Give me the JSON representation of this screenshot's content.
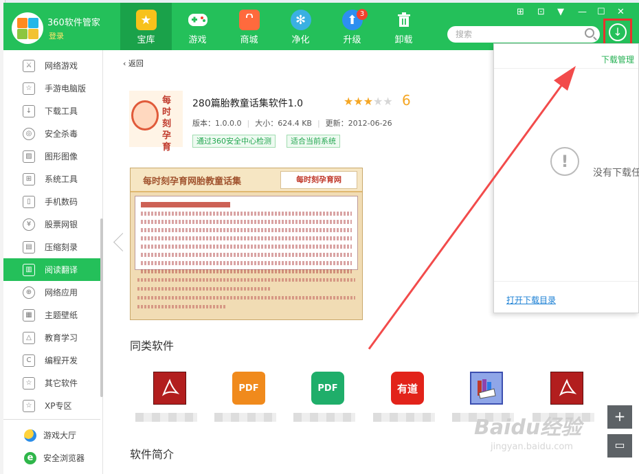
{
  "app": {
    "brand": "360软件管家",
    "login": "登录"
  },
  "nav": [
    {
      "label": "宝库",
      "color": "#f7c21b"
    },
    {
      "label": "游戏",
      "color": "#ffffff"
    },
    {
      "label": "商城",
      "color": "#ff6a3d"
    },
    {
      "label": "净化",
      "color": "#3ab0e2"
    },
    {
      "label": "升级",
      "color": "#2d8ff0",
      "badge": "3"
    },
    {
      "label": "卸载",
      "color": "#ffffff"
    }
  ],
  "search": {
    "placeholder": "搜索"
  },
  "sidebar": {
    "items": [
      {
        "label": "网络游戏"
      },
      {
        "label": "手游电脑版"
      },
      {
        "label": "下载工具"
      },
      {
        "label": "安全杀毒"
      },
      {
        "label": "图形图像"
      },
      {
        "label": "系统工具"
      },
      {
        "label": "手机数码"
      },
      {
        "label": "股票网银"
      },
      {
        "label": "压缩刻录"
      },
      {
        "label": "阅读翻译"
      },
      {
        "label": "网络应用"
      },
      {
        "label": "主题壁纸"
      },
      {
        "label": "教育学习"
      },
      {
        "label": "编程开发"
      },
      {
        "label": "其它软件"
      },
      {
        "label": "XP专区"
      }
    ],
    "apps": [
      {
        "label": "游戏大厅"
      },
      {
        "label": "安全浏览器"
      }
    ]
  },
  "detail": {
    "back": "返回",
    "title": "280篇胎教童话集软件1.0",
    "rating": "6",
    "stars_on": 3,
    "version_label": "版本：1.0.0.0",
    "size_label": "大小：624.4 KB",
    "update_label": "更新：2012-06-26",
    "tags": [
      "通过360安全中心检测",
      "适合当前系统"
    ],
    "logo_text": "每时刻孕育",
    "screenshot": {
      "title": "每时刻孕育网胎教童话集",
      "site": "每时刻孕育网"
    }
  },
  "sections": {
    "similar": "同类软件",
    "intro": "软件简介"
  },
  "similar_apps": [
    {
      "icon": "acrobat",
      "color": "#b21e1e",
      "text": "A"
    },
    {
      "icon": "foxit-pdf",
      "color": "#f08a1c",
      "text": "PDF"
    },
    {
      "icon": "pdf",
      "color": "#1fae6a",
      "text": "PDF"
    },
    {
      "icon": "youdao",
      "color": "#e2231a",
      "text": "有道"
    },
    {
      "icon": "dictionary",
      "color": "#5a6fd6",
      "text": ""
    },
    {
      "icon": "acrobat",
      "color": "#b21e1e",
      "text": "A"
    }
  ],
  "download_popup": {
    "title": "下载管理",
    "empty": "没有下载任",
    "open_dir": "打开下载目录"
  },
  "watermark": {
    "main": "Baidu经验",
    "sub": "jingyan.baidu.com"
  },
  "colors": {
    "brand_green": "#24c05a",
    "highlight_red": "#e8322d",
    "star": "#f5a623"
  }
}
